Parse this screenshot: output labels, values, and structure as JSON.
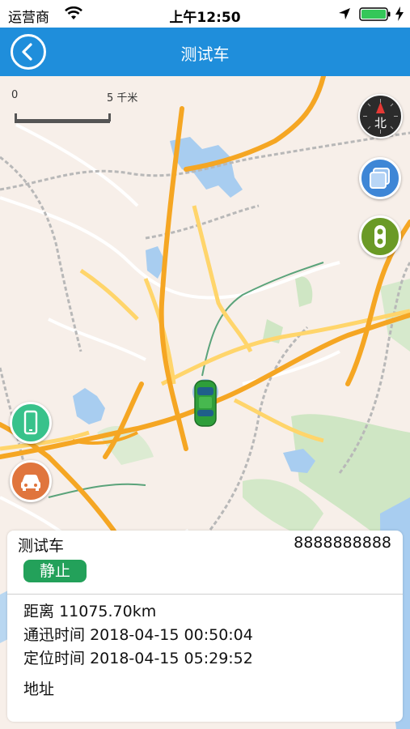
{
  "status_bar": {
    "carrier": "运营商",
    "time": "上午12:50"
  },
  "nav": {
    "title": "测试车"
  },
  "map": {
    "scale_start": "0",
    "scale_end": "5 千米",
    "compass_label": "北"
  },
  "vehicle_card": {
    "name": "测试车",
    "phone": "8888888888",
    "status": "静止",
    "distance_label": "距离",
    "distance_value": "11075.70km",
    "comm_time_label": "通迅时间",
    "comm_time_value": "2018-04-15 00:50:04",
    "loc_time_label": "定位时间",
    "loc_time_value": "2018-04-15 05:29:52",
    "address_label": "地址"
  },
  "colors": {
    "nav_blue": "#1f8edb",
    "status_green": "#23a15a",
    "road_orange": "#f5a623",
    "road_yellow": "#ffd56b"
  },
  "icons": {
    "back": "back-circle-arrow-icon",
    "compass": "compass-north-icon",
    "layers": "map-layers-icon",
    "traffic": "traffic-light-icon",
    "phone": "phone-locate-icon",
    "car": "car-locate-icon"
  }
}
